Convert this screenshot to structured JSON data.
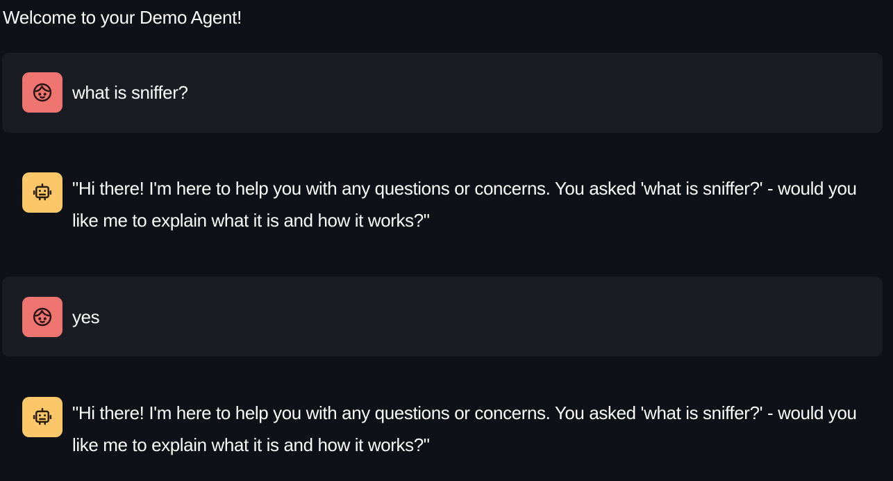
{
  "page": {
    "title": "Welcome to your Demo Agent!"
  },
  "colors": {
    "background": "#0e1117",
    "user_bubble": "#1a1c24",
    "user_avatar": "#ee7470",
    "assistant_avatar": "#fcc769",
    "text": "#fafafa"
  },
  "chat": {
    "messages": [
      {
        "role": "user",
        "avatar_icon": "user-face-icon",
        "text": "what is sniffer?"
      },
      {
        "role": "assistant",
        "avatar_icon": "robot-icon",
        "text": "\"Hi there! I'm here to help you with any questions or concerns. You asked 'what is sniffer?' - would you like me to explain what it is and how it works?\""
      },
      {
        "role": "user",
        "avatar_icon": "user-face-icon",
        "text": "yes"
      },
      {
        "role": "assistant",
        "avatar_icon": "robot-icon",
        "text": "\"Hi there! I'm here to help you with any questions or concerns. You asked 'what is sniffer?' - would you like me to explain what it is and how it works?\""
      }
    ]
  }
}
